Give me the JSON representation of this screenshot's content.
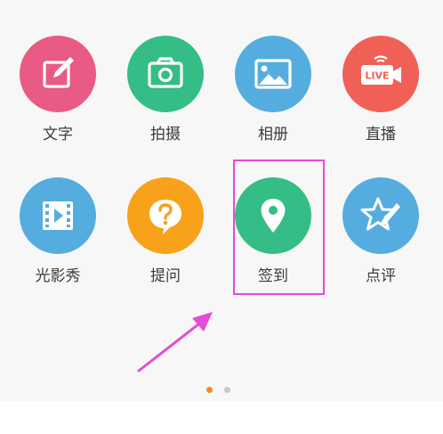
{
  "grid": {
    "items": [
      {
        "label": "文字",
        "icon": "edit-icon",
        "color": "#e95b84"
      },
      {
        "label": "拍摄",
        "icon": "camera-icon",
        "color": "#34bd84"
      },
      {
        "label": "相册",
        "icon": "image-icon",
        "color": "#55addf"
      },
      {
        "label": "直播",
        "icon": "live-camera-icon",
        "color": "#f16057",
        "badge": "LIVE"
      },
      {
        "label": "光影秀",
        "icon": "video-frames-icon",
        "color": "#55addf"
      },
      {
        "label": "提问",
        "icon": "question-bubble-icon",
        "color": "#f7a21a"
      },
      {
        "label": "签到",
        "icon": "location-pin-icon",
        "color": "#34bd84"
      },
      {
        "label": "点评",
        "icon": "star-pen-icon",
        "color": "#55addf"
      }
    ]
  },
  "annotation": {
    "highlight_color": "#e64ad8",
    "highlighted_item": "签到"
  },
  "pager": {
    "page_count": 2,
    "active_page": 1,
    "active_color": "#f28a2a",
    "inactive_color": "#c8c8c8"
  }
}
